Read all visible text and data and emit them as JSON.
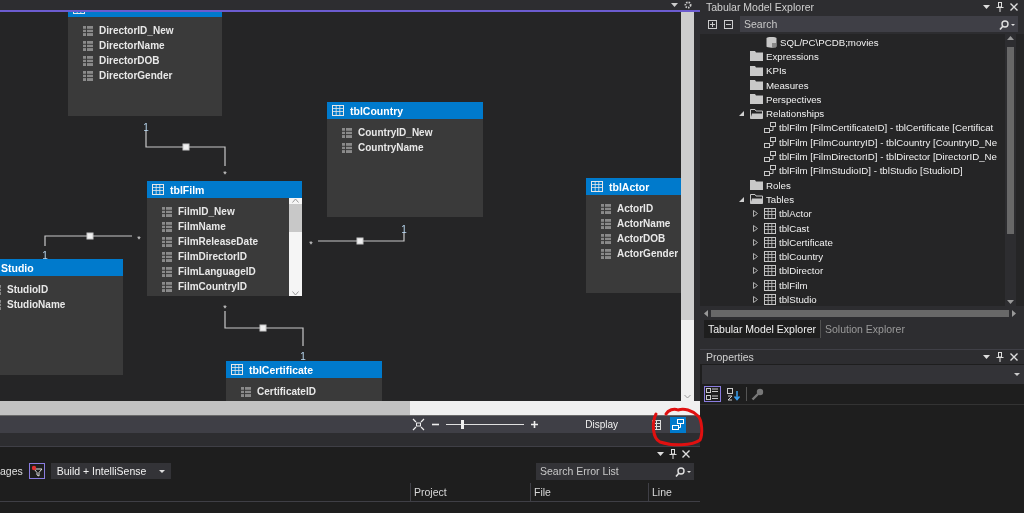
{
  "diagram": {
    "tables": [
      {
        "columns": [
          "DirectorID_New",
          "DirectorName",
          "DirectorDOB",
          "DirectorGender"
        ]
      },
      {
        "name": "tblCountry",
        "columns": [
          "CountryID_New",
          "CountryName"
        ]
      },
      {
        "name": "tblFilm",
        "columns": [
          "FilmID_New",
          "FilmName",
          "FilmReleaseDate",
          "FilmDirectorID",
          "FilmLanguageID",
          "FilmCountryID"
        ]
      },
      {
        "name": "tblActor",
        "columns": [
          "ActorID",
          "ActorName",
          "ActorDOB",
          "ActorGender"
        ]
      },
      {
        "name": "Studio",
        "columns": [
          "StudioID",
          "StudioName"
        ]
      },
      {
        "name": "tblCertificate",
        "columns": [
          "CertificateID"
        ]
      }
    ],
    "relationships": [
      {
        "one": "1",
        "many": "*"
      },
      {
        "one": "1",
        "many": "*"
      },
      {
        "one": "1",
        "many": "*"
      },
      {
        "one": "1",
        "many": "*"
      }
    ]
  },
  "diagram_toolbar": {
    "zoom": {
      "level": 0.2
    },
    "display_label": "Display",
    "views": [
      {
        "kind": "table",
        "selected": false
      },
      {
        "kind": "diagram",
        "selected": true
      }
    ]
  },
  "error_list": {
    "tab_fragment": "ages",
    "build_filter": "Build + IntelliSense",
    "search": {
      "placeholder": "Search Error List"
    },
    "columns": [
      "Project",
      "File",
      "Line"
    ]
  },
  "model_explorer": {
    "title": "Tabular Model Explorer",
    "search": {
      "placeholder": "Search"
    },
    "tree": [
      {
        "label": "SQL/PC\\PCDB;movies",
        "kind": "connection"
      },
      {
        "label": "Expressions",
        "kind": "folder"
      },
      {
        "label": "KPIs",
        "kind": "folder"
      },
      {
        "label": "Measures",
        "kind": "folder"
      },
      {
        "label": "Perspectives",
        "kind": "folder"
      },
      {
        "label": "Relationships",
        "kind": "folder",
        "expanded": true,
        "children": [
          {
            "label": "tblFilm [FilmCertificateID] - tblCertificate [Certificat",
            "kind": "relationship"
          },
          {
            "label": "tblFilm [FilmCountryID] - tblCountry [CountryID_Ne",
            "kind": "relationship"
          },
          {
            "label": "tblFilm [FilmDirectorID] - tblDirector [DirectorID_Ne",
            "kind": "relationship"
          },
          {
            "label": "tblFilm [FilmStudioID] - tblStudio [StudioID]",
            "kind": "relationship"
          }
        ]
      },
      {
        "label": "Roles",
        "kind": "folder"
      },
      {
        "label": "Tables",
        "kind": "folder",
        "expanded": true,
        "children": [
          {
            "label": "tblActor",
            "kind": "table",
            "expanded": false
          },
          {
            "label": "tblCast",
            "kind": "table",
            "expanded": false
          },
          {
            "label": "tblCertificate",
            "kind": "table",
            "expanded": false
          },
          {
            "label": "tblCountry",
            "kind": "table",
            "expanded": false
          },
          {
            "label": "tblDirector",
            "kind": "table",
            "expanded": false
          },
          {
            "label": "tblFilm",
            "kind": "table",
            "expanded": false
          },
          {
            "label": "tblStudio",
            "kind": "table",
            "expanded": false
          }
        ]
      }
    ],
    "tabs": [
      {
        "label": "Tabular Model Explorer",
        "selected": true
      },
      {
        "label": "Solution Explorer",
        "selected": false
      }
    ]
  },
  "properties": {
    "title": "Properties",
    "sort_modes": [
      {
        "kind": "categorized",
        "selected": true
      },
      {
        "kind": "alphabetical",
        "selected": false
      }
    ]
  }
}
